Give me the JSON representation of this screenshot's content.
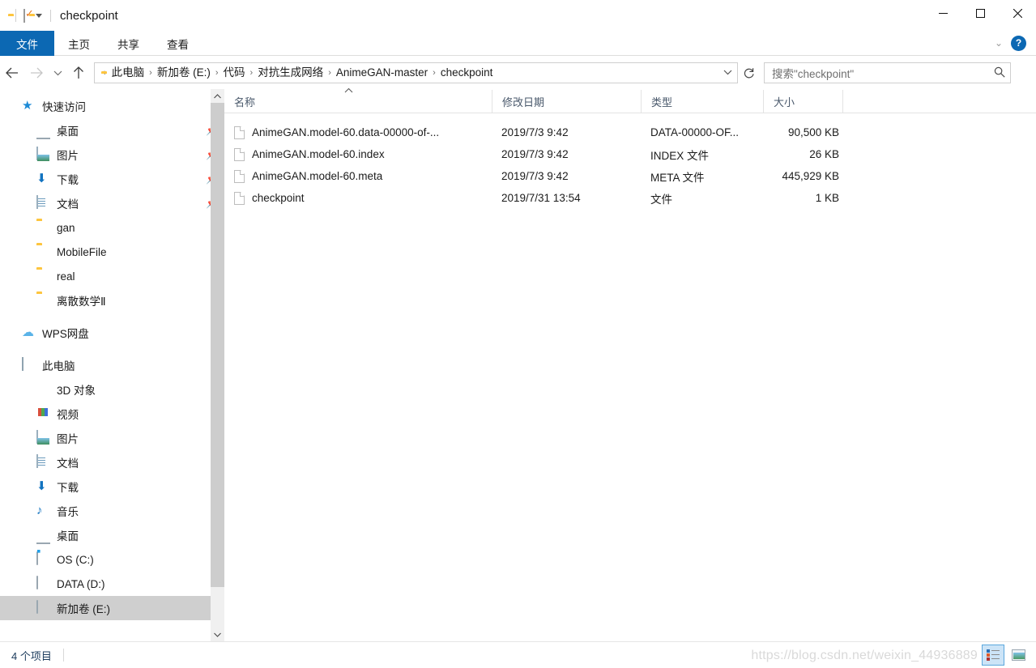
{
  "titlebar": {
    "title": "checkpoint",
    "quick_access": [
      {
        "name": "folder-icon",
        "label": ""
      },
      {
        "name": "properties-checkbox-icon",
        "label": ""
      },
      {
        "name": "new-folder-icon",
        "label": ""
      },
      {
        "name": "customize-quick-access-caret",
        "label": ""
      }
    ],
    "minimize": "—",
    "maximize": "☐",
    "close": "✕"
  },
  "ribbon": {
    "tabs": [
      {
        "id": "file",
        "label": "文件",
        "active": true
      },
      {
        "id": "home",
        "label": "主页",
        "active": false
      },
      {
        "id": "share",
        "label": "共享",
        "active": false
      },
      {
        "id": "view",
        "label": "查看",
        "active": false
      }
    ],
    "collapse_caret": "⌄",
    "help_label": "?",
    "accent_color": "#0c68b3"
  },
  "nav": {
    "back": "←",
    "forward": "→",
    "recent": "⌄",
    "up": "↑",
    "breadcrumbs": [
      "此电脑",
      "新加卷 (E:)",
      "代码",
      "对抗生成网络",
      "AnimeGAN-master",
      "checkpoint"
    ],
    "separator": "›",
    "address_caret": "⌄",
    "refresh": "↻"
  },
  "search": {
    "placeholder": "搜索\"checkpoint\"",
    "value": "搜索\"checkpoint\"",
    "icon": "search-icon"
  },
  "sidebar": {
    "groups": [
      {
        "header": {
          "label": "快速访问",
          "icon": "star-pin-icon"
        },
        "items": [
          {
            "label": "桌面",
            "icon": "desktop-icon",
            "pinned": true
          },
          {
            "label": "图片",
            "icon": "pictures-icon",
            "pinned": true
          },
          {
            "label": "下载",
            "icon": "downloads-icon",
            "pinned": true
          },
          {
            "label": "文档",
            "icon": "documents-icon",
            "pinned": true
          },
          {
            "label": "gan",
            "icon": "folder-icon",
            "pinned": false
          },
          {
            "label": "MobileFile",
            "icon": "folder-icon",
            "pinned": false
          },
          {
            "label": "real",
            "icon": "folder-icon",
            "pinned": false
          },
          {
            "label": "离散数学Ⅱ",
            "icon": "folder-icon",
            "pinned": false
          }
        ]
      },
      {
        "header": {
          "label": "WPS网盘",
          "icon": "cloud-icon"
        },
        "items": []
      },
      {
        "header": {
          "label": "此电脑",
          "icon": "this-pc-icon"
        },
        "items": [
          {
            "label": "3D 对象",
            "icon": "3d-objects-icon",
            "pinned": false
          },
          {
            "label": "视频",
            "icon": "videos-icon",
            "pinned": false
          },
          {
            "label": "图片",
            "icon": "pictures-icon",
            "pinned": false
          },
          {
            "label": "文档",
            "icon": "documents-icon",
            "pinned": false
          },
          {
            "label": "下载",
            "icon": "downloads-icon",
            "pinned": false
          },
          {
            "label": "音乐",
            "icon": "music-icon",
            "pinned": false
          },
          {
            "label": "桌面",
            "icon": "desktop-icon",
            "pinned": false
          },
          {
            "label": "OS (C:)",
            "icon": "os-drive-icon",
            "pinned": false
          },
          {
            "label": "DATA (D:)",
            "icon": "drive-icon",
            "pinned": false
          },
          {
            "label": "新加卷 (E:)",
            "icon": "drive-icon",
            "pinned": false,
            "selected": true
          }
        ]
      }
    ],
    "pin_glyph": "📌",
    "scroll_up": "⌃",
    "scroll_down": "⌄"
  },
  "filelist": {
    "columns": [
      {
        "key": "name",
        "label": "名称",
        "sorted": "asc"
      },
      {
        "key": "date",
        "label": "修改日期",
        "sorted": null
      },
      {
        "key": "type",
        "label": "类型",
        "sorted": null
      },
      {
        "key": "size",
        "label": "大小",
        "sorted": null
      }
    ],
    "sort_caret": "⌃",
    "rows": [
      {
        "name": "AnimeGAN.model-60.data-00000-of-...",
        "date": "2019/7/3 9:42",
        "type": "DATA-00000-OF...",
        "size": "90,500 KB",
        "icon": "generic-file-icon"
      },
      {
        "name": "AnimeGAN.model-60.index",
        "date": "2019/7/3 9:42",
        "type": "INDEX 文件",
        "size": "26 KB",
        "icon": "generic-file-icon"
      },
      {
        "name": "AnimeGAN.model-60.meta",
        "date": "2019/7/3 9:42",
        "type": "META 文件",
        "size": "445,929 KB",
        "icon": "generic-file-icon"
      },
      {
        "name": "checkpoint",
        "date": "2019/7/31 13:54",
        "type": "文件",
        "size": "1 KB",
        "icon": "generic-file-icon"
      }
    ]
  },
  "statusbar": {
    "item_count": "4 个项目",
    "watermark": "https://blog.csdn.net/weixin_44936889",
    "views": [
      {
        "name": "details-view-button",
        "active": true
      },
      {
        "name": "large-icons-view-button",
        "active": false
      }
    ]
  }
}
